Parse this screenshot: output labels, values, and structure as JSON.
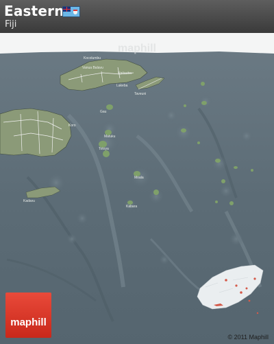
{
  "header": {
    "title": "Eastern",
    "subtitle": "Fiji"
  },
  "watermark": "maphill",
  "logo": {
    "text": "maphill"
  },
  "copyright": "© 2011 Maphill",
  "map": {
    "place_labels": [
      "Kocolumbu",
      "Lakeba",
      "Kadavu",
      "Kabara",
      "Moala",
      "Totoya",
      "Matuku",
      "Vanua Balavu",
      "Taveuni",
      "Koro",
      "Gau",
      "Naitauba"
    ],
    "colors": {
      "ocean": "#5f6f79",
      "land": "#8a9978",
      "land_outline": "#f2f2f2",
      "ice": "#e9eef0",
      "highlight": "#d45a4a"
    }
  }
}
